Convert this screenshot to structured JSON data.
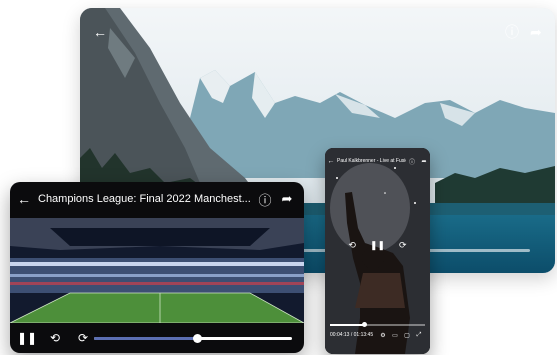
{
  "background_player": {
    "back_icon": "arrow-left-icon",
    "info_icon": "info-icon",
    "share_icon": "share-icon",
    "progress": 0.0,
    "colors": {
      "controls": "#ffffff"
    }
  },
  "desktop_player": {
    "title": "Champions League: Final 2022 Manchest...",
    "back_icon": "arrow-left-icon",
    "info_icon": "info-icon",
    "share_icon": "share-icon",
    "pause_icon": "pause-icon",
    "rewind_icon": "rewind-10-icon",
    "forward_icon": "forward-10-icon",
    "progress": 0.52,
    "colors": {
      "accent": "#5c6fb3",
      "background": "#0b0b0d"
    }
  },
  "mobile_player": {
    "title": "Paul Kalkbrenner - Live at Fusion Festival",
    "back_icon": "arrow-left-icon",
    "info_icon": "info-icon",
    "share_icon": "share-icon",
    "play_icon": "pause-icon",
    "rewind_icon": "rewind-10-icon",
    "forward_icon": "forward-10-icon",
    "time": "00:04:13 / 01:13:45",
    "settings_icon": "gear-icon",
    "subtitles_icon": "subtitles-icon",
    "cast_icon": "cast-icon",
    "fullscreen_icon": "fullscreen-icon",
    "progress": 0.36
  }
}
